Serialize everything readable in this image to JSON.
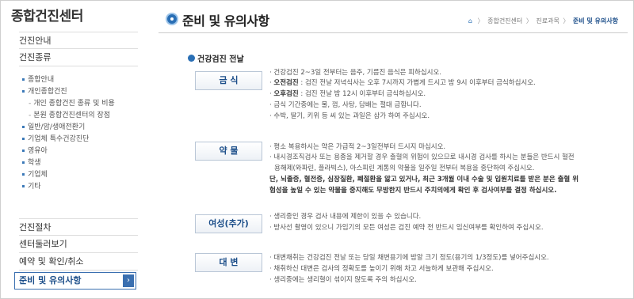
{
  "sidebar": {
    "title": "종합건진센터",
    "main_items": [
      "건진안내",
      "건진종류"
    ],
    "sub_items": [
      {
        "label": "종합안내",
        "indent": false
      },
      {
        "label": "개인종합건진",
        "indent": false
      },
      {
        "label": "개인 종합건진 종류 및 비용",
        "indent": true
      },
      {
        "label": "본원 종합건진센터의 장점",
        "indent": true
      },
      {
        "label": "일반/암/생애전환기",
        "indent": false
      },
      {
        "label": "기업체 특수건강진단",
        "indent": false
      },
      {
        "label": "영유아",
        "indent": false
      },
      {
        "label": "학생",
        "indent": false
      },
      {
        "label": "기업체",
        "indent": false
      },
      {
        "label": "기타",
        "indent": false
      }
    ],
    "bottom_items": [
      "건진절차",
      "센터둘러보기",
      "예약 및 확인/취소"
    ],
    "active_item": "준비 및 유의사항",
    "active_arrow": "›"
  },
  "header": {
    "title": "준비 및 유의사항",
    "breadcrumb": {
      "home_icon": "house-icon",
      "home": "⌂",
      "items": [
        "종합건진센터",
        "진료과목"
      ],
      "current": "준비 및 유의사항"
    }
  },
  "section": {
    "title": "건강검진 전날",
    "categories": [
      {
        "label": "금 식",
        "lines": [
          {
            "text": "건강검진 2~3일 전부터는 음주, 기름진 음식은 피하십시오.",
            "bold_prefix": ""
          },
          {
            "text": " : 검진 전날 저녁식사는 오후 7시까지 가볍게 드시고 밤 9시 이후부터 금식하십시오.",
            "bold_prefix": "오전검진"
          },
          {
            "text": " : 검진 전날 밤 12시 이후부터 금식하십시오.",
            "bold_prefix": "오후검진"
          },
          {
            "text": "금식 기간중에는 물, 껌, 사탕, 담배는 절대 금합니다.",
            "bold_prefix": ""
          },
          {
            "text": "수박, 딸기, 키위 등 씨 있는 과일은 삼가 하여 주십시오.",
            "bold_prefix": ""
          }
        ]
      },
      {
        "label": "약 물",
        "lines": [
          {
            "text": "평소 복용하시는 약은 가급적 2~3일전부터 드시지 마십시오.",
            "bold_prefix": ""
          },
          {
            "text": "내시경조직검사 또는 용종을 제거할 경우 출혈의 위험이 있으므로 내시경 검사를 하시는 분들은 반드시 혈전",
            "bold_prefix": ""
          },
          {
            "text": "용해제(와파린, 플라빅스), 아스피린 계통의 약물을 일주일 전부터 복용을 중단하여 주십시오.",
            "bold_prefix": "",
            "cont": true
          },
          {
            "text": "단, 뇌졸증, 혈전증, 심장질환, 폐절환을 앓고 있거나, 최근 3개월 이내 수술 및 입원치료를 받은 분은 출혈 위",
            "bold_prefix": "",
            "bold": true,
            "nobullet": true
          },
          {
            "text": "험성을 높일 수 있는 약물을 중지해도 무방한지 반드시 주치의에게 확인 후 검사여부를 결정 하십시오.",
            "bold_prefix": "",
            "bold": true,
            "nobullet": true
          }
        ]
      },
      {
        "label": "여성(추가)",
        "lines": [
          {
            "text": "생리중인 경우 검사 내용에 제한이 있을 수 있습니다.",
            "bold_prefix": ""
          },
          {
            "text": "방사선 촬영이 있으니 가임기의 모든 여성은 검진 예약 전 반드시 임신여부를 확인하여 주십시오.",
            "bold_prefix": ""
          }
        ]
      },
      {
        "label": "대 변",
        "lines": [
          {
            "text": "대변채취는 건강검진 전날 또는 당일 채변용기에 밤알 크기 정도(용기의 1/3정도)를 넣어주십시오.",
            "bold_prefix": ""
          },
          {
            "text": "채취하신 대변은 검사의 정확도를 높이기 위해 차고 서늘하게 보관해 주십시오.",
            "bold_prefix": ""
          },
          {
            "text": "생리중에는 생리혈이 섞이지 않도록 주의 하십시오.",
            "bold_prefix": ""
          }
        ]
      }
    ]
  }
}
